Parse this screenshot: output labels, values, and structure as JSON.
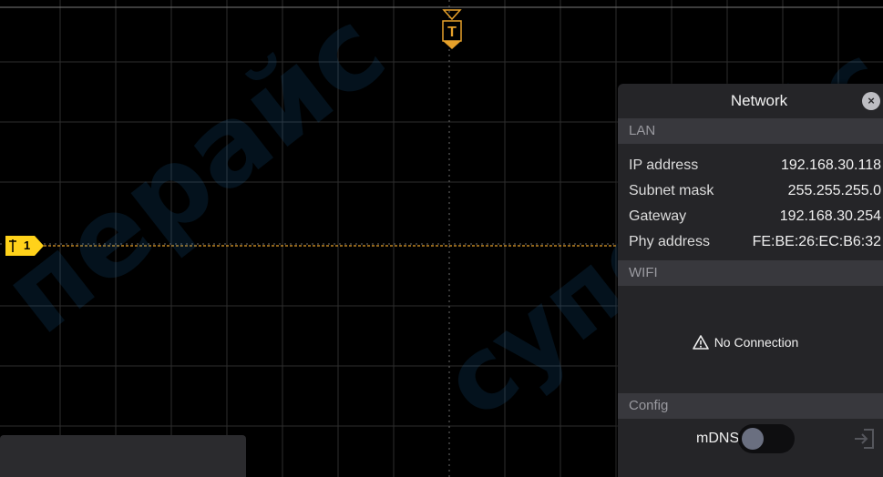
{
  "watermark": {
    "text1": "перайс",
    "text2": "суперайс"
  },
  "trigger": {
    "label": "T"
  },
  "channel1": {
    "label": "1"
  },
  "dialog": {
    "title": "Network",
    "close_label": "×",
    "lan": {
      "section_label": "LAN",
      "rows": [
        {
          "key": "IP address",
          "value": "192.168.30.118"
        },
        {
          "key": "Subnet mask",
          "value": "255.255.255.0"
        },
        {
          "key": "Gateway",
          "value": "192.168.30.254"
        },
        {
          "key": "Phy address",
          "value": "FE:BE:26:EC:B6:32"
        }
      ]
    },
    "wifi": {
      "section_label": "WIFI",
      "status": "No Connection"
    },
    "config": {
      "section_label": "Config",
      "mdns_label": "mDNS",
      "mdns_enabled": false
    }
  },
  "colors": {
    "trace": "#f0a020",
    "marker": "#ffd21a",
    "grid": "#3a3a3a",
    "dialog_bg": "#252528",
    "section_bar": "#38383d"
  },
  "icons": {
    "close": "close-icon",
    "warning": "warning-icon",
    "exit": "exit-icon"
  }
}
